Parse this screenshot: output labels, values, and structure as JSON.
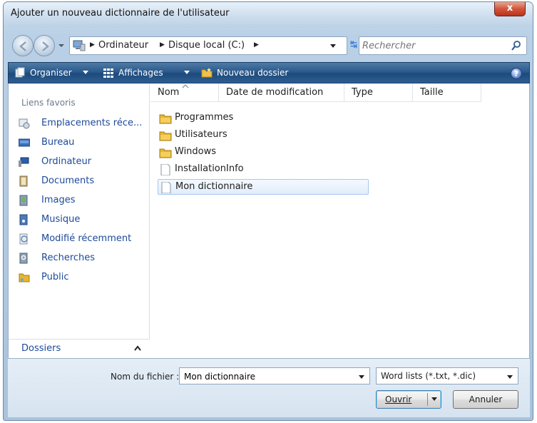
{
  "window": {
    "title": "Ajouter un nouveau dictionnaire de l'utilisateur",
    "close_label": "x"
  },
  "address": {
    "segments": [
      "Ordinateur",
      "Disque local (C:)"
    ],
    "search_placeholder": "Rechercher"
  },
  "toolbar": {
    "organiser": "Organiser",
    "affichages": "Affichages",
    "nouveau_dossier": "Nouveau dossier",
    "help": "?"
  },
  "sidebar": {
    "header": "Liens favoris",
    "items": [
      {
        "label": "Emplacements réce...",
        "icon": "recent-places-icon"
      },
      {
        "label": "Bureau",
        "icon": "desktop-icon"
      },
      {
        "label": "Ordinateur",
        "icon": "computer-icon"
      },
      {
        "label": "Documents",
        "icon": "documents-icon"
      },
      {
        "label": "Images",
        "icon": "pictures-icon"
      },
      {
        "label": "Musique",
        "icon": "music-icon"
      },
      {
        "label": "Modifié récemment",
        "icon": "recently-changed-icon"
      },
      {
        "label": "Recherches",
        "icon": "searches-icon"
      },
      {
        "label": "Public",
        "icon": "public-folder-icon"
      }
    ],
    "folders_label": "Dossiers"
  },
  "columns": [
    "Nom",
    "Date de modification",
    "Type",
    "Taille"
  ],
  "files": [
    {
      "name": "Programmes",
      "kind": "folder"
    },
    {
      "name": "Utilisateurs",
      "kind": "folder"
    },
    {
      "name": "Windows",
      "kind": "folder"
    },
    {
      "name": "InstallationInfo",
      "kind": "file"
    },
    {
      "name": "Mon dictionnaire",
      "kind": "file",
      "selected": true
    }
  ],
  "bottom": {
    "filename_label": "Nom du fichier :",
    "filename_value": "Mon dictionnaire",
    "filetype_value": "Word lists (*.txt, *.dic)",
    "open_label": "Ouvrir",
    "cancel_label": "Annuler"
  },
  "colors": {
    "toolbar": "#2b5a8c",
    "link": "#1c4a9a",
    "folder": "#e8b531",
    "selection_border": "#a6c8ee"
  }
}
